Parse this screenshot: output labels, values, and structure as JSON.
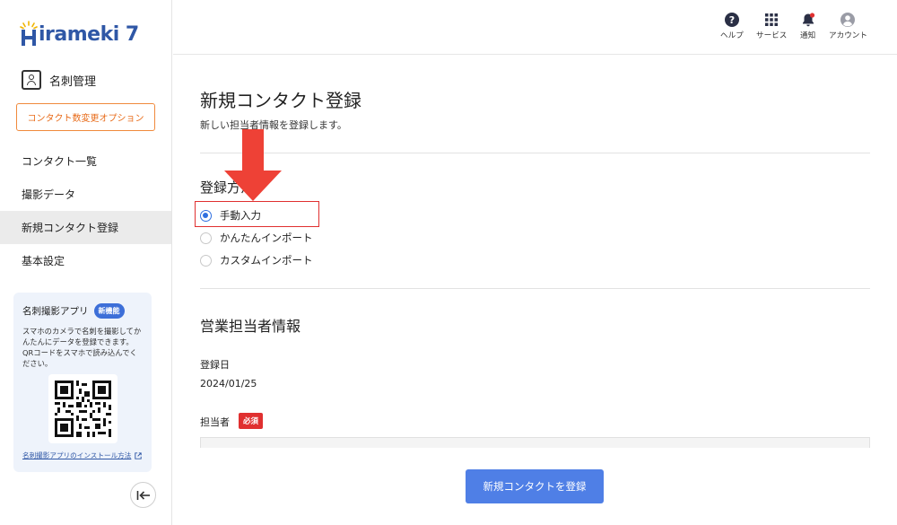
{
  "app": {
    "logo_text": "irameki 7",
    "brand_color": "#2f57a6",
    "accent_color": "#4f7fe6"
  },
  "sidebar": {
    "section_icon": "business-card-icon",
    "section_title": "名刺管理",
    "option_button": "コンタクト数変更オプション",
    "items": [
      {
        "label": "コンタクト一覧",
        "active": false
      },
      {
        "label": "撮影データ",
        "active": false
      },
      {
        "label": "新規コンタクト登録",
        "active": true
      },
      {
        "label": "基本設定",
        "active": false
      }
    ],
    "promo": {
      "title": "名刺撮影アプリ",
      "badge": "新機能",
      "description": "スマホのカメラで名刺を撮影してかんたんにデータを登録できます。QRコードをスマホで読み込んでください。",
      "link": "名刺撮影アプリのインストール方法",
      "qr_icon": "qr-code-icon"
    },
    "collapse_icon": "collapse-left-icon"
  },
  "header": {
    "items": [
      {
        "icon": "help-icon",
        "label": "ヘルプ"
      },
      {
        "icon": "grid-icon",
        "label": "サービス"
      },
      {
        "icon": "bell-icon",
        "label": "通知"
      },
      {
        "icon": "account-icon",
        "label": "アカウント"
      }
    ],
    "notification_dot_color": "#e03030"
  },
  "main": {
    "title": "新規コンタクト登録",
    "subtitle": "新しい担当者情報を登録します。",
    "registration_method": {
      "title": "登録方法",
      "options": [
        {
          "label": "手動入力",
          "checked": true
        },
        {
          "label": "かんたんインポート",
          "checked": false
        },
        {
          "label": "カスタムインポート",
          "checked": false
        }
      ]
    },
    "sales_section": {
      "title": "営業担当者情報",
      "registered_date_label": "登録日",
      "registered_date_value": "2024/01/25",
      "person_label": "担当者",
      "required_badge": "必須"
    },
    "submit_button": "新規コンタクトを登録"
  }
}
